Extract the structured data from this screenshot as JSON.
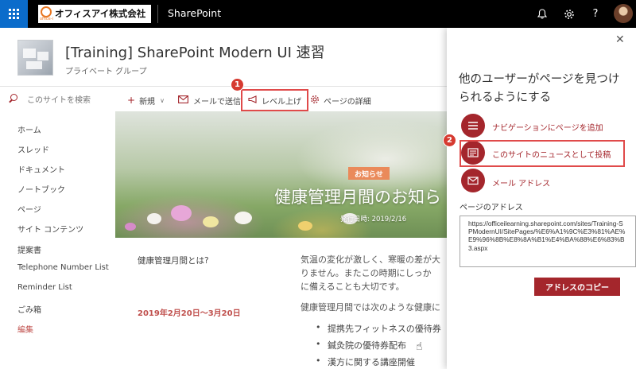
{
  "suite": {
    "org_name": "オフィスアイ株式会社",
    "org_mark_sub": "office-i",
    "app_name": "SharePoint",
    "icons": [
      "waffle-icon",
      "bell-icon",
      "gear-icon",
      "help-icon",
      "avatar"
    ]
  },
  "site": {
    "title": "[Training] SharePoint Modern UI 速習",
    "subtitle": "プライベート グループ"
  },
  "search": {
    "placeholder": "このサイトを検索"
  },
  "nav": {
    "items": [
      "ホーム",
      "スレッド",
      "ドキュメント",
      "ノートブック",
      "ページ",
      "サイト コンテンツ",
      "提案書",
      "Telephone Number List",
      "Reminder List",
      "ごみ箱",
      "編集"
    ]
  },
  "commands": {
    "new": "新規",
    "email": "メールで送信",
    "promote": "レベル上げ",
    "details": "ページの詳細"
  },
  "annotations": {
    "step1": "1",
    "step2": "2"
  },
  "hero": {
    "tag": "お知らせ",
    "title": "健康管理月間のお知ら",
    "date": "発行日時: 2019/2/16"
  },
  "body": {
    "question": "健康管理月間とは?",
    "date_range": "2019年2月20日～3月20日",
    "para_lines": [
      "気温の変化が激しく、寒暖の差が大",
      "りません。またこの時期にしっか",
      "に備えることも大切です。"
    ],
    "intro": "健康管理月間では次のような健康に",
    "bullets": [
      "提携先フィットネスの優待券",
      "鍼灸院の優待券配布",
      "漢方に関する講座開催"
    ]
  },
  "panel": {
    "title": "他のユーザーがページを見つけられるようにする",
    "actions": [
      "ナビゲーションにページを追加",
      "このサイトのニュースとして投稿",
      "メール アドレス"
    ],
    "url_label": "ページのアドレス",
    "url": "https://officeilearning.sharepoint.com/sites/Training-SPModernUI/SitePages/%E6%A1%9C%E3%81%AE%E9%96%8B%E8%8A%B1%E4%BA%88%E6%83%B3.aspx",
    "copy_label": "アドレスのコピー"
  },
  "colors": {
    "suite_bg": "#000000",
    "waffle": "#0b6ccb",
    "accent": "#a4262c",
    "highlight": "#e04a4a",
    "tag": "#ea8a5a"
  }
}
